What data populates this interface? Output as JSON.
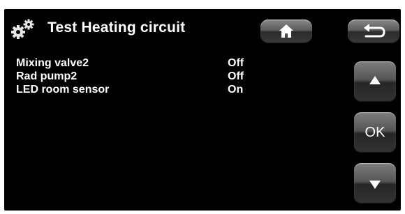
{
  "header": {
    "title": "Test Heating circuit",
    "icon": "gears-icon"
  },
  "rows": [
    {
      "label": "Mixing valve2",
      "value": "Off"
    },
    {
      "label": "Rad pump2",
      "value": "Off"
    },
    {
      "label": "LED room sensor",
      "value": "On"
    }
  ],
  "buttons": {
    "home": "home-icon",
    "back": "return-arrow-icon",
    "up": "arrow-up-icon",
    "ok_label": "OK",
    "down": "arrow-down-icon"
  },
  "colors": {
    "background": "#000000",
    "text": "#ffffff",
    "button_top": "#8a8a8a",
    "button_bottom": "#2c2c2c"
  }
}
